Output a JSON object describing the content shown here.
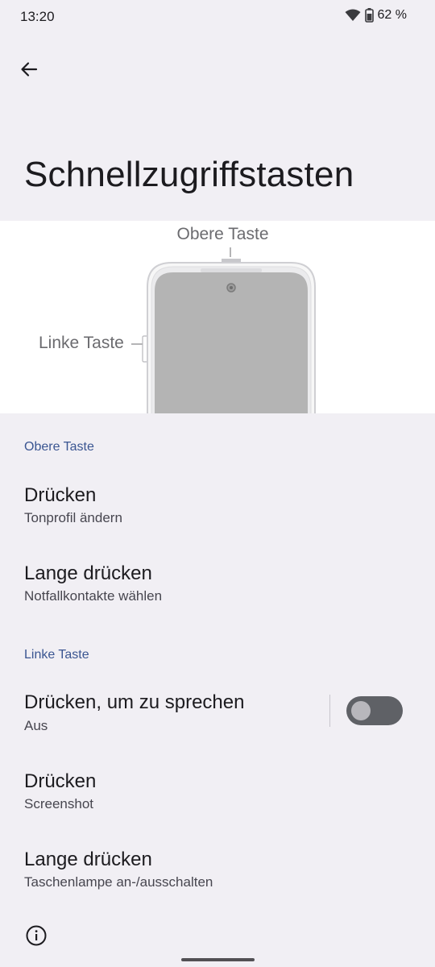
{
  "status_bar": {
    "time": "13:20",
    "battery": "62 %"
  },
  "header": {
    "title": "Schnellzugriffstasten"
  },
  "illustration": {
    "top_label": "Obere Taste",
    "left_label": "Linke Taste"
  },
  "sections": [
    {
      "title": "Obere Taste",
      "items": [
        {
          "title": "Drücken",
          "subtitle": "Tonprofil ändern"
        },
        {
          "title": "Lange drücken",
          "subtitle": "Notfallkontakte wählen"
        }
      ]
    },
    {
      "title": "Linke Taste",
      "items": [
        {
          "title": "Drücken, um zu sprechen",
          "subtitle": "Aus",
          "toggle_on": false
        },
        {
          "title": "Drücken",
          "subtitle": "Screenshot"
        },
        {
          "title": "Lange drücken",
          "subtitle": "Taschenlampe an-/ausschalten"
        }
      ]
    }
  ],
  "colors": {
    "accent": "#3a5591",
    "background": "#f1eff4",
    "toggle_off": "#5f6166"
  }
}
